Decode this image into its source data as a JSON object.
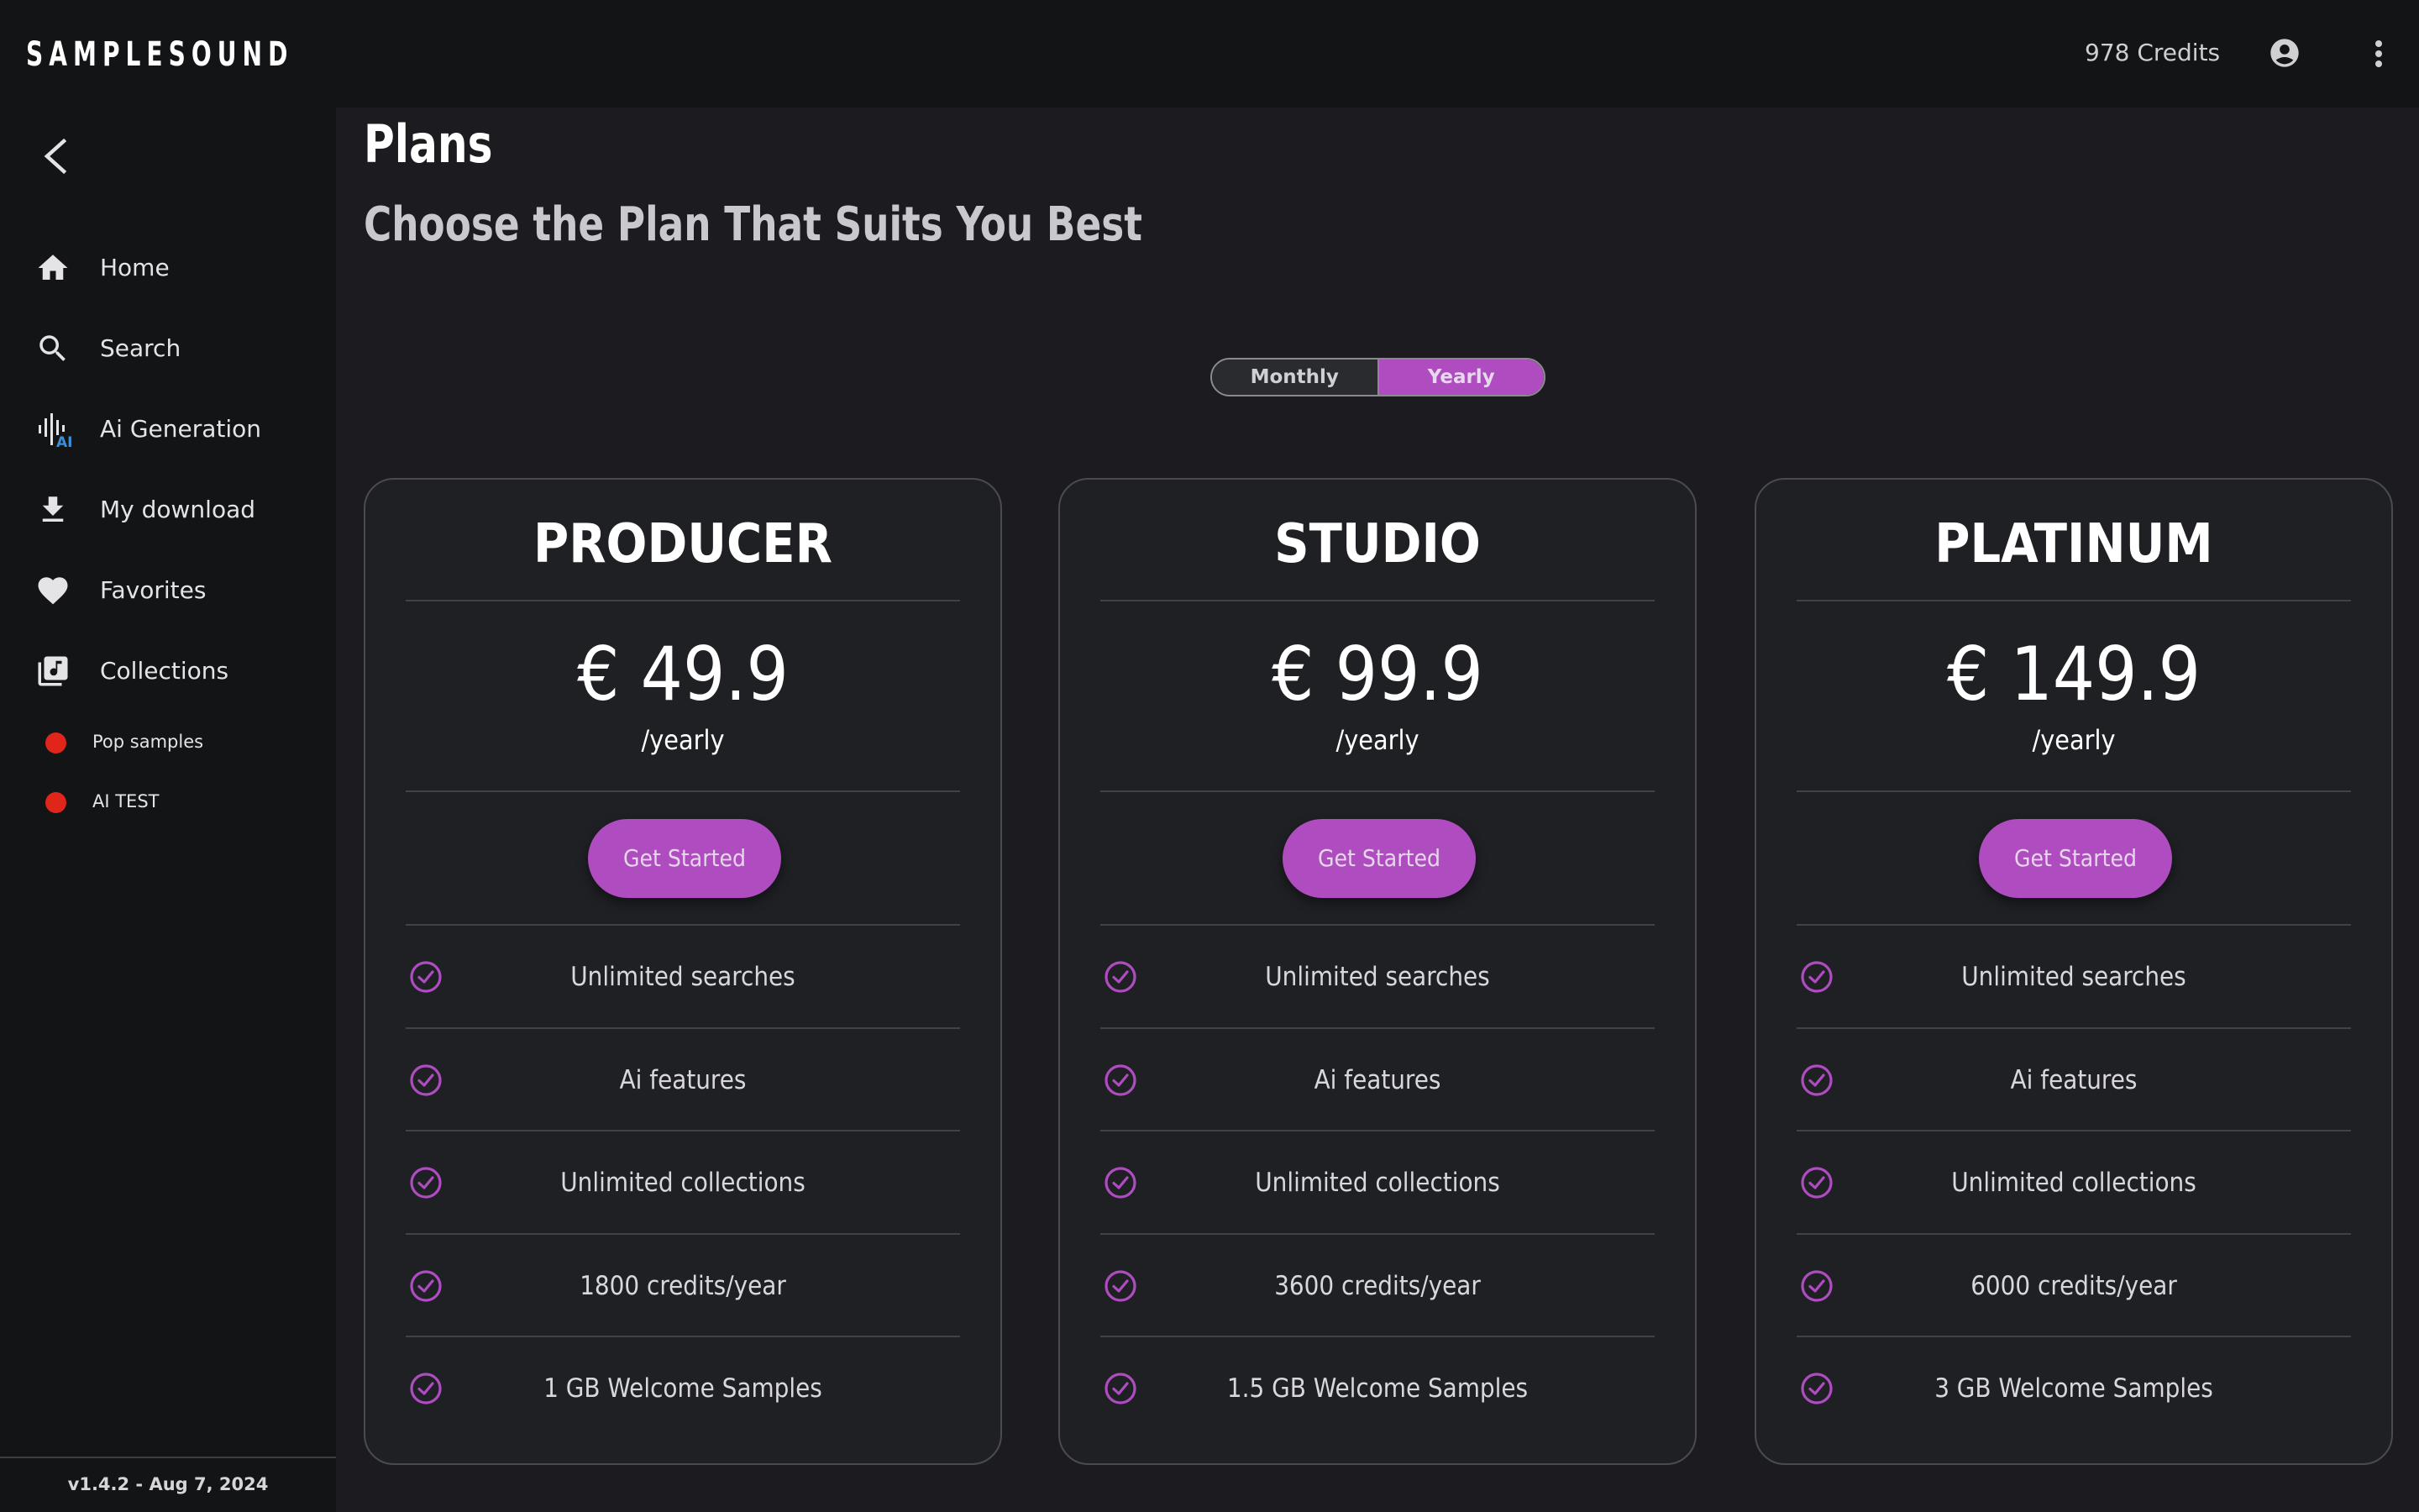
{
  "header": {
    "logo": "SAMPLESOUND",
    "credits": "978 Credits",
    "profile_icon": "account-circle-icon",
    "menu_icon": "more-vertical-icon"
  },
  "sidebar": {
    "back_icon": "chevron-left-icon",
    "items": [
      {
        "label": "Home",
        "icon": "home-icon"
      },
      {
        "label": "Search",
        "icon": "search-icon"
      },
      {
        "label": "Ai Generation",
        "icon": "ai-waveform-icon"
      },
      {
        "label": "My download",
        "icon": "download-icon"
      },
      {
        "label": "Favorites",
        "icon": "heart-icon"
      },
      {
        "label": "Collections",
        "icon": "library-music-icon"
      }
    ],
    "collections": [
      {
        "label": "Pop samples",
        "color": "#e0251b"
      },
      {
        "label": "AI TEST",
        "color": "#e0251b"
      }
    ],
    "version": "v1.4.2 - Aug 7, 2024"
  },
  "main": {
    "title": "Plans",
    "subtitle": "Choose the Plan That Suits You Best",
    "billing_toggle": {
      "options": [
        "Monthly",
        "Yearly"
      ],
      "selected": "Yearly"
    },
    "plans": [
      {
        "name": "PRODUCER",
        "price": "€ 49.9",
        "period": "/yearly",
        "cta": "Get Started",
        "features": [
          "Unlimited searches",
          "Ai features",
          "Unlimited collections",
          "1800 credits/year",
          "1 GB Welcome Samples"
        ]
      },
      {
        "name": "STUDIO",
        "price": "€ 99.9",
        "period": "/yearly",
        "cta": "Get Started",
        "features": [
          "Unlimited searches",
          "Ai features",
          "Unlimited collections",
          "3600 credits/year",
          "1.5 GB Welcome Samples"
        ]
      },
      {
        "name": "PLATINUM",
        "price": "€ 149.9",
        "period": "/yearly",
        "cta": "Get Started",
        "features": [
          "Unlimited searches",
          "Ai features",
          "Unlimited collections",
          "6000 credits/year",
          "3 GB Welcome Samples"
        ]
      }
    ]
  },
  "colors": {
    "accent": "#ae4cc0",
    "ai_badge": "#3a8fd8",
    "collection_dot": "#e0251b"
  }
}
